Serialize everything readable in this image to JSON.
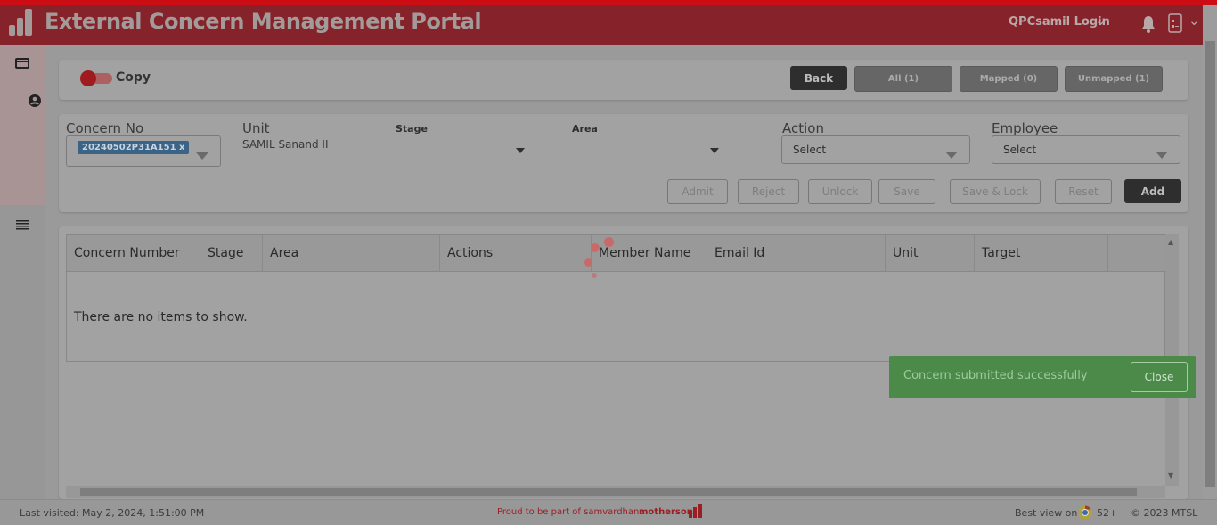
{
  "header": {
    "title": "External Concern Management Portal",
    "login": "QPCsamil Login",
    "icons": [
      "bar-logo-icon",
      "chevron-down-icon",
      "bell-icon",
      "document-list-icon"
    ]
  },
  "sidebar": {
    "icons": [
      "card-icon",
      "user-circle-icon",
      "menu-icon"
    ]
  },
  "toolbar": {
    "copy_label": "Copy",
    "copy_toggle_on": true,
    "back": "Back",
    "all": "All (1)",
    "mapped": "Mapped (0)",
    "unmapped": "Unmapped (1)"
  },
  "form": {
    "concern_no_label": "Concern No",
    "concern_no_tag": "20240502P31A151",
    "tag_remove": "x",
    "unit_label": "Unit",
    "unit_value": "SAMIL Sanand II",
    "stage_label": "Stage",
    "area_label": "Area",
    "action_label": "Action",
    "action_value": "Select",
    "employee_label": "Employee",
    "employee_value": "Select",
    "buttons": [
      "Admit",
      "Reject",
      "Unlock",
      "Save",
      "Save & Lock",
      "Reset",
      "Add"
    ]
  },
  "table": {
    "columns": [
      "Concern Number",
      "Stage",
      "Area",
      "Actions",
      "Member Name",
      "Email Id",
      "Unit",
      "Target"
    ],
    "empty": "There are no items to show."
  },
  "toast": {
    "message": "Concern submitted successfully",
    "close": "Close",
    "color": "#4c8a4a"
  },
  "footer": {
    "last_visited": "Last visited: May 2, 2024, 1:51:00 PM",
    "proud": "Proud to be part of samvardhana",
    "brand": "motherson",
    "best_view": "Best view on",
    "browser_version": "52+",
    "copyright": "© 2023 MTSL"
  },
  "colors": {
    "header": "#86232a",
    "accent": "#cc0e14"
  }
}
